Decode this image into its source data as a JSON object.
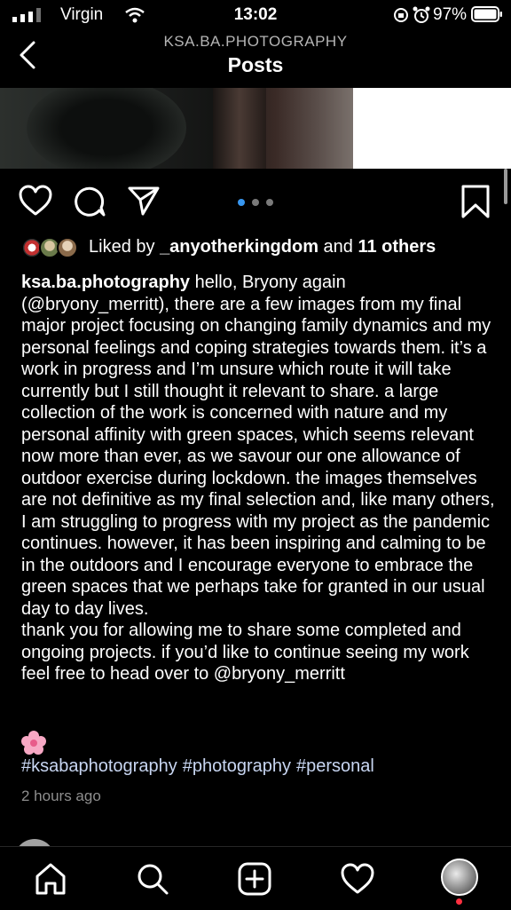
{
  "status_bar": {
    "carrier": "Virgin",
    "time": "13:02",
    "battery_percent": "97%"
  },
  "header": {
    "account": "KSA.BA.PHOTOGRAPHY",
    "title": "Posts"
  },
  "carousel": {
    "dot_count": 3,
    "active_dot": 0,
    "active_color": "#3897f0"
  },
  "likes": {
    "prefix": "Liked by ",
    "user": "_anyotherkingdom",
    "middle": " and ",
    "others": "11 others"
  },
  "caption": {
    "username": "ksa.ba.photography",
    "para1": "hello, Bryony again (@bryony_merritt), there are a few images from my final major project focusing on changing family dynamics and my personal feelings and coping strategies towards them. it’s a work in progress and I’m unsure which route it will take currently but I still thought it relevant to share. a large collection of the work is concerned with nature and my personal affinity with green spaces, which seems relevant now more than ever, as we savour our one allowance of outdoor exercise during lockdown. the images themselves are not definitive as my final selection and, like many others, I am struggling to progress with my project as the pandemic continues. however, it has been inspiring and calming to be in the outdoors and I encourage everyone to embrace the green spaces that we perhaps take for granted in our usual day to day lives.",
    "para2": "thank you for allowing me to share some completed and ongoing projects. if you’d like to continue seeing my work feel free to head over to @bryony_merritt",
    "emoji": "🌸",
    "hashtags": [
      "#ksabaphotography",
      "#photography",
      "#personal"
    ],
    "hashtag_color": "#c8d6f2",
    "time_ago": "2 hours ago"
  },
  "icons": {
    "back": "chevron-left-icon",
    "like": "heart-outline-icon",
    "comment": "comment-bubble-icon",
    "share": "paper-plane-icon",
    "save": "bookmark-icon",
    "home": "home-icon",
    "search": "search-icon",
    "new_post": "add-square-icon",
    "activity": "heart-outline-icon",
    "profile": "profile-avatar"
  }
}
